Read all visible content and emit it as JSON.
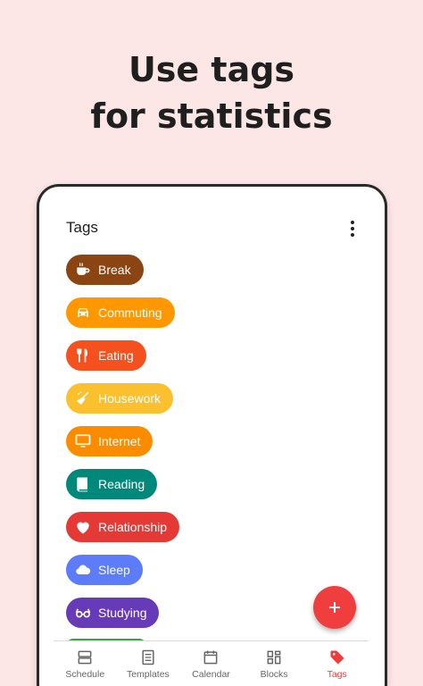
{
  "headline": {
    "line1": "Use tags",
    "line2": "for statistics"
  },
  "appbar": {
    "title": "Tags",
    "more_icon": "more-vert-icon"
  },
  "tags": [
    {
      "label": "Break",
      "color": "#8b4513",
      "icon": "coffee-icon"
    },
    {
      "label": "Commuting",
      "color": "#ff9800",
      "icon": "car-icon"
    },
    {
      "label": "Eating",
      "color": "#f4511e",
      "icon": "utensils-icon"
    },
    {
      "label": "Housework",
      "color": "#fbc02d",
      "icon": "broom-icon"
    },
    {
      "label": "Internet",
      "color": "#fb8c00",
      "icon": "monitor-icon"
    },
    {
      "label": "Reading",
      "color": "#00897b",
      "icon": "book-icon"
    },
    {
      "label": "Relationship",
      "color": "#e53935",
      "icon": "heart-icon"
    },
    {
      "label": "Sleep",
      "color": "#5c7cfa",
      "icon": "cloud-icon"
    },
    {
      "label": "Studying",
      "color": "#673ab7",
      "icon": "glasses-icon"
    }
  ],
  "fab": {
    "icon": "plus-icon",
    "color": "#f03e3e"
  },
  "bottom_nav": [
    {
      "label": "Schedule",
      "icon": "schedule-icon",
      "active": false
    },
    {
      "label": "Templates",
      "icon": "templates-icon",
      "active": false
    },
    {
      "label": "Calendar",
      "icon": "calendar-icon",
      "active": false
    },
    {
      "label": "Blocks",
      "icon": "blocks-icon",
      "active": false
    },
    {
      "label": "Tags",
      "icon": "tag-icon",
      "active": true
    }
  ],
  "colors": {
    "background": "#fde6e6",
    "accent": "#ef3b3b"
  }
}
